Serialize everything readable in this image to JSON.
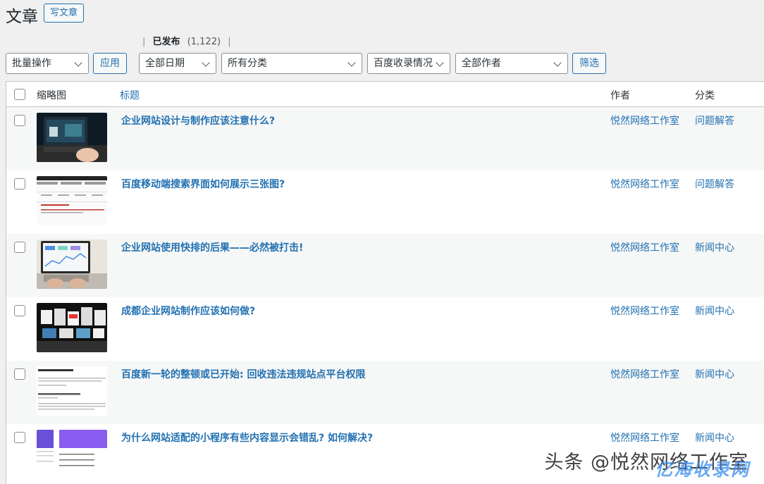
{
  "header": {
    "title": "文章",
    "add_new": "写文章"
  },
  "views": {
    "published_label": "已发布",
    "published_count": "(1,122)"
  },
  "toolbar": {
    "bulk_actions": "批量操作",
    "apply": "应用",
    "all_dates": "全部日期",
    "all_categories": "所有分类",
    "baidu_index": "百度收录情况",
    "all_authors": "全部作者",
    "filter": "筛选"
  },
  "table": {
    "columns": {
      "thumbnail": "缩略图",
      "title": "标题",
      "author": "作者",
      "category": "分类"
    },
    "rows": [
      {
        "title": "企业网站设计与制作应该注意什么?",
        "author": "悦然网络工作室",
        "category": "问题解答"
      },
      {
        "title": "百度移动端搜索界面如何展示三张图?",
        "author": "悦然网络工作室",
        "category": "问题解答"
      },
      {
        "title": "企业网站使用快排的后果——必然被打击!",
        "author": "悦然网络工作室",
        "category": "新闻中心"
      },
      {
        "title": "成都企业网站制作应该如何做?",
        "author": "悦然网络工作室",
        "category": "新闻中心"
      },
      {
        "title": "百度新一轮的整顿或已开始: 回收违法违规站点平台权限",
        "author": "悦然网络工作室",
        "category": "新闻中心"
      },
      {
        "title": "为什么网站适配的小程序有些内容显示会错乱? 如何解决?",
        "author": "悦然网络工作室",
        "category": "新闻中心"
      }
    ]
  },
  "watermark": {
    "line1": "头条 @悦然网络工作室",
    "line2": "亿海收录网"
  }
}
